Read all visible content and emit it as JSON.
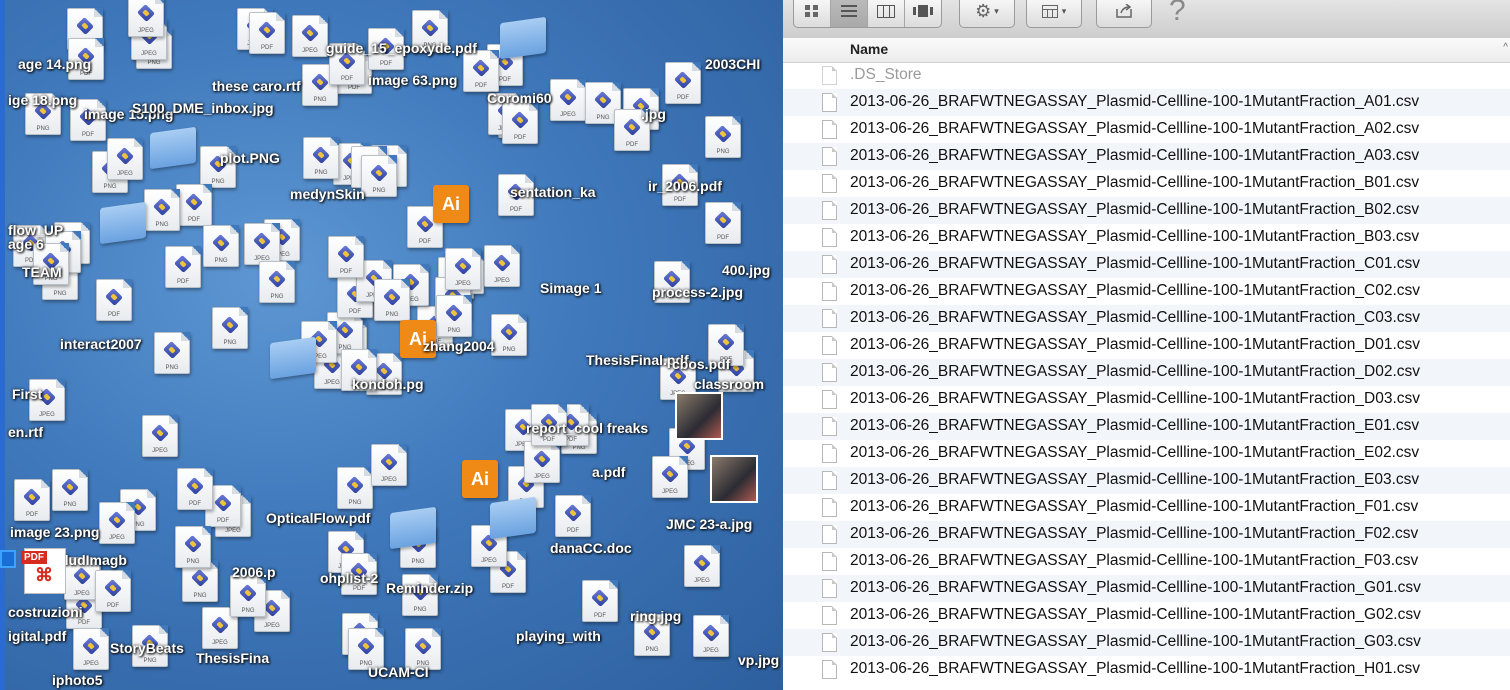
{
  "desktop": {
    "labels": [
      "guide_15_epoxyde.pdf",
      "age 14.png",
      "these caro.rtf",
      "2003CHI",
      "image 63.png",
      "Coromi60",
      "ige 18.png",
      "image 15.png",
      "S100_DME_inbox.jpg",
      ".jpg",
      "plot.PNG",
      "medynSkin",
      "sentation_ka",
      "ir_2006.pdf",
      "process-2.jpg",
      "flow_UP",
      "age 6",
      "TEAM",
      "400.jpg",
      "Simage 1",
      "interact2007",
      "zhang2004",
      "ThesisFinal.pdf",
      "cbos.pdf",
      "classroom",
      "kondoh.pg",
      "First",
      "en.rtf",
      "report_cool freaks",
      "image 23.png",
      "OpticalFlow.pdf",
      "JMC 23-a.jpg",
      "danaCC.doc",
      "Reminder.zip",
      "iphoto5",
      "costruzioni",
      "igital.pdf",
      "StoryBeats",
      "ThesisFina",
      "vp.jpg",
      "ring.jpg",
      "UCAM-Cl",
      "playing_with",
      "a.pdf",
      "2006.p",
      "ohplist-2",
      "dudImagb"
    ],
    "icon_tags": {
      "pdf": "PDF",
      "png": "PNG",
      "jpg": "JPEG",
      "ai": "Ai",
      "adobe": "Adobe"
    }
  },
  "finder": {
    "toolbar": {
      "view_icons": "icon-view-icon",
      "view_list": "list-view-icon",
      "view_columns": "column-view-icon",
      "view_coverflow": "coverflow-view-icon",
      "action": "gear-icon",
      "arrange": "arrange-icon",
      "share": "share-icon",
      "help": "?"
    },
    "column_header": "Name",
    "files": [
      ".DS_Store",
      "2013-06-26_BRAFWTNEGASSAY_Plasmid-Cellline-100-1MutantFraction_A01.csv",
      "2013-06-26_BRAFWTNEGASSAY_Plasmid-Cellline-100-1MutantFraction_A02.csv",
      "2013-06-26_BRAFWTNEGASSAY_Plasmid-Cellline-100-1MutantFraction_A03.csv",
      "2013-06-26_BRAFWTNEGASSAY_Plasmid-Cellline-100-1MutantFraction_B01.csv",
      "2013-06-26_BRAFWTNEGASSAY_Plasmid-Cellline-100-1MutantFraction_B02.csv",
      "2013-06-26_BRAFWTNEGASSAY_Plasmid-Cellline-100-1MutantFraction_B03.csv",
      "2013-06-26_BRAFWTNEGASSAY_Plasmid-Cellline-100-1MutantFraction_C01.csv",
      "2013-06-26_BRAFWTNEGASSAY_Plasmid-Cellline-100-1MutantFraction_C02.csv",
      "2013-06-26_BRAFWTNEGASSAY_Plasmid-Cellline-100-1MutantFraction_C03.csv",
      "2013-06-26_BRAFWTNEGASSAY_Plasmid-Cellline-100-1MutantFraction_D01.csv",
      "2013-06-26_BRAFWTNEGASSAY_Plasmid-Cellline-100-1MutantFraction_D02.csv",
      "2013-06-26_BRAFWTNEGASSAY_Plasmid-Cellline-100-1MutantFraction_D03.csv",
      "2013-06-26_BRAFWTNEGASSAY_Plasmid-Cellline-100-1MutantFraction_E01.csv",
      "2013-06-26_BRAFWTNEGASSAY_Plasmid-Cellline-100-1MutantFraction_E02.csv",
      "2013-06-26_BRAFWTNEGASSAY_Plasmid-Cellline-100-1MutantFraction_E03.csv",
      "2013-06-26_BRAFWTNEGASSAY_Plasmid-Cellline-100-1MutantFraction_F01.csv",
      "2013-06-26_BRAFWTNEGASSAY_Plasmid-Cellline-100-1MutantFraction_F02.csv",
      "2013-06-26_BRAFWTNEGASSAY_Plasmid-Cellline-100-1MutantFraction_F03.csv",
      "2013-06-26_BRAFWTNEGASSAY_Plasmid-Cellline-100-1MutantFraction_G01.csv",
      "2013-06-26_BRAFWTNEGASSAY_Plasmid-Cellline-100-1MutantFraction_G02.csv",
      "2013-06-26_BRAFWTNEGASSAY_Plasmid-Cellline-100-1MutantFraction_G03.csv",
      "2013-06-26_BRAFWTNEGASSAY_Plasmid-Cellline-100-1MutantFraction_H01.csv"
    ]
  },
  "colors": {
    "desktop": "#3f78bb",
    "row_alt": "#f2f5fa",
    "toolbar": "#d6d6d6"
  }
}
